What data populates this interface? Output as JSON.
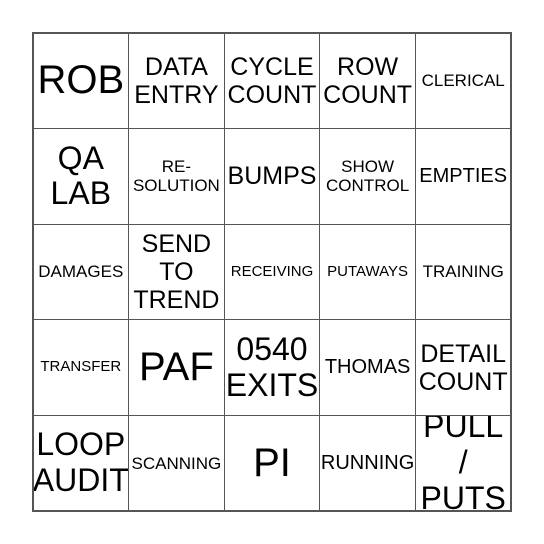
{
  "card": {
    "cells": [
      {
        "text": "ROB",
        "size": "xxl"
      },
      {
        "text": "DATA\nENTRY",
        "size": "lg"
      },
      {
        "text": "CYCLE\nCOUNT",
        "size": "lg"
      },
      {
        "text": "ROW\nCOUNT",
        "size": "lg"
      },
      {
        "text": "CLERICAL",
        "size": "sm"
      },
      {
        "text": "QA\nLAB",
        "size": "xl"
      },
      {
        "text": "RE-\nSOLUTION",
        "size": "sm"
      },
      {
        "text": "BUMPS",
        "size": "lg"
      },
      {
        "text": "SHOW\nCONTROL",
        "size": "sm"
      },
      {
        "text": "EMPTIES",
        "size": "md"
      },
      {
        "text": "DAMAGES",
        "size": "sm"
      },
      {
        "text": "SEND\nTO\nTREND",
        "size": "lg"
      },
      {
        "text": "RECEIVING",
        "size": "xs"
      },
      {
        "text": "PUTAWAYS",
        "size": "xs"
      },
      {
        "text": "TRAINING",
        "size": "sm"
      },
      {
        "text": "TRANSFER",
        "size": "xs"
      },
      {
        "text": "PAF",
        "size": "xxl"
      },
      {
        "text": "0540\nEXITS",
        "size": "xl"
      },
      {
        "text": "THOMAS",
        "size": "md"
      },
      {
        "text": "DETAIL\nCOUNT",
        "size": "lg"
      },
      {
        "text": "LOOP\nAUDIT",
        "size": "xl"
      },
      {
        "text": "SCANNING",
        "size": "sm"
      },
      {
        "text": "PI",
        "size": "xxl"
      },
      {
        "text": "RUNNING",
        "size": "md"
      },
      {
        "text": "PULL /\nPUTS",
        "size": "xl"
      }
    ]
  }
}
